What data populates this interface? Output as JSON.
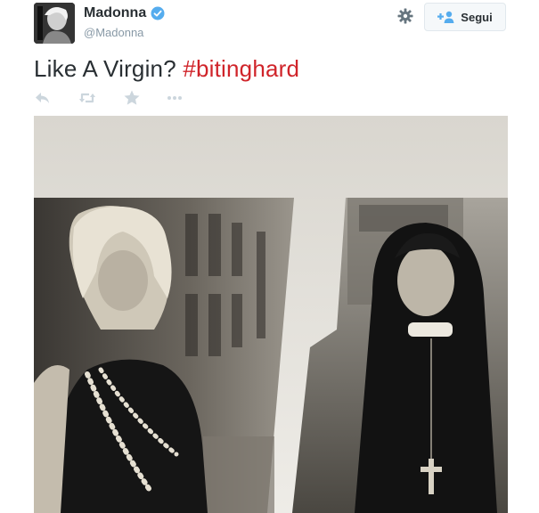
{
  "tweet": {
    "display_name": "Madonna",
    "handle": "@Madonna",
    "text_plain": "Like A Virgin? ",
    "hashtag": "#bitinghard",
    "follow_label": "Segui"
  },
  "icons": {
    "verified": "verified-badge-icon",
    "settings": "gear-icon",
    "follow": "follow-user-icon",
    "reply": "reply-icon",
    "retweet": "retweet-icon",
    "favorite": "star-icon",
    "more": "more-dots-icon"
  },
  "colors": {
    "hashtag": "#d0242a",
    "verified": "#55acee",
    "follow_icon": "#55acee"
  }
}
